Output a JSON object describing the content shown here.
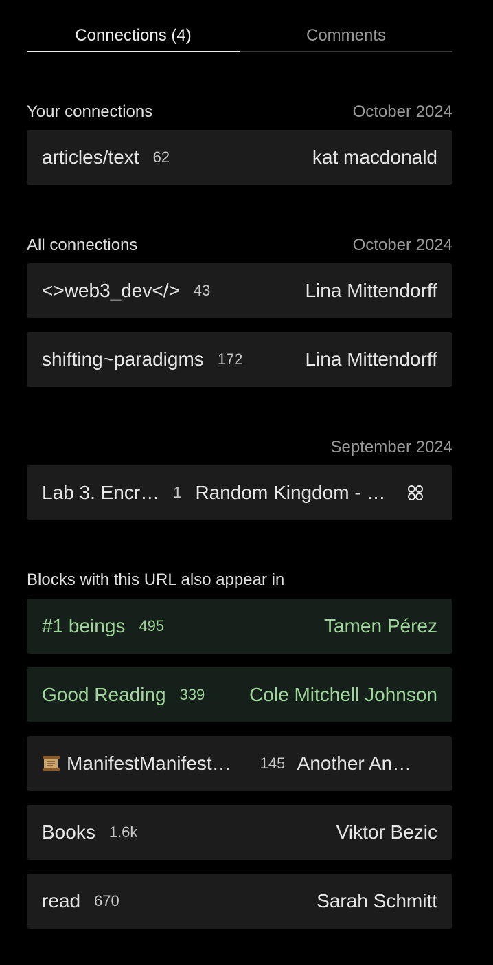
{
  "tabs": {
    "connections": "Connections (4)",
    "comments": "Comments"
  },
  "your_connections": {
    "title": "Your connections",
    "date": "October 2024",
    "items": [
      {
        "title": "articles/text",
        "count": "62",
        "owner": "kat macdonald"
      }
    ]
  },
  "all_connections": {
    "title": "All connections",
    "date": "October 2024",
    "items": [
      {
        "title": "<>web3_dev</>",
        "count": "43",
        "owner": "Lina Mittendorff"
      },
      {
        "title": "shifting~paradigms",
        "count": "172",
        "owner": "Lina Mittendorff"
      }
    ],
    "september": {
      "date": "September 2024",
      "items": [
        {
          "title": "Lab 3. Encr…",
          "count": "1",
          "owner": "Random Kingdom - …",
          "icon": "group-icon"
        }
      ]
    }
  },
  "url_blocks": {
    "title": "Blocks with this URL also appear in",
    "items": [
      {
        "title": "#1 beings",
        "count": "495",
        "owner": "Tamen Pérez",
        "highlight": true
      },
      {
        "title": "Good Reading",
        "count": "339",
        "owner": "Cole Mitchell Johnson",
        "highlight": true
      },
      {
        "title": "ManifestManifest…",
        "count": "145",
        "owner": "Another An…",
        "icon": "scroll-icon"
      },
      {
        "title": "Books",
        "count": "1.6k",
        "owner": "Viktor Bezic"
      },
      {
        "title": "read",
        "count": "670",
        "owner": "Sarah Schmitt"
      }
    ]
  },
  "colors": {
    "background": "#000000",
    "row": "#1c1c1c",
    "row_highlight": "#16201a",
    "highlight_text": "#9fd59a"
  }
}
